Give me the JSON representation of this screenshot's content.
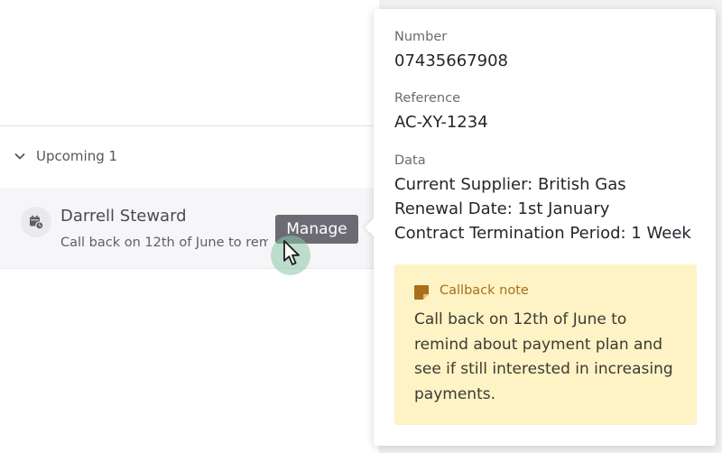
{
  "list": {
    "section_label": "Upcoming 1",
    "item": {
      "name": "Darrell Steward",
      "subtitle": "Call back on 12th of June to remind about payment plan",
      "icon": "calendar-clock-icon"
    },
    "manage_label": "Manage"
  },
  "popover": {
    "number_label": "Number",
    "number_value": "07435667908",
    "reference_label": "Reference",
    "reference_value": "AC-XY-1234",
    "data_label": "Data",
    "data_lines": [
      "Current Supplier: British Gas",
      "Renewal Date: 1st January",
      "Contract Termination Period: 1 Week"
    ],
    "note": {
      "title": "Callback note",
      "text": "Call back on 12th of June to remind about payment plan and see if still interested in increasing payments.",
      "icon": "sticky-note-icon"
    }
  },
  "colors": {
    "note_background": "#fdf3c5",
    "note_title": "#a8701a",
    "manage_button": "#6b6b73",
    "cursor_halo": "#8cc8a5"
  }
}
